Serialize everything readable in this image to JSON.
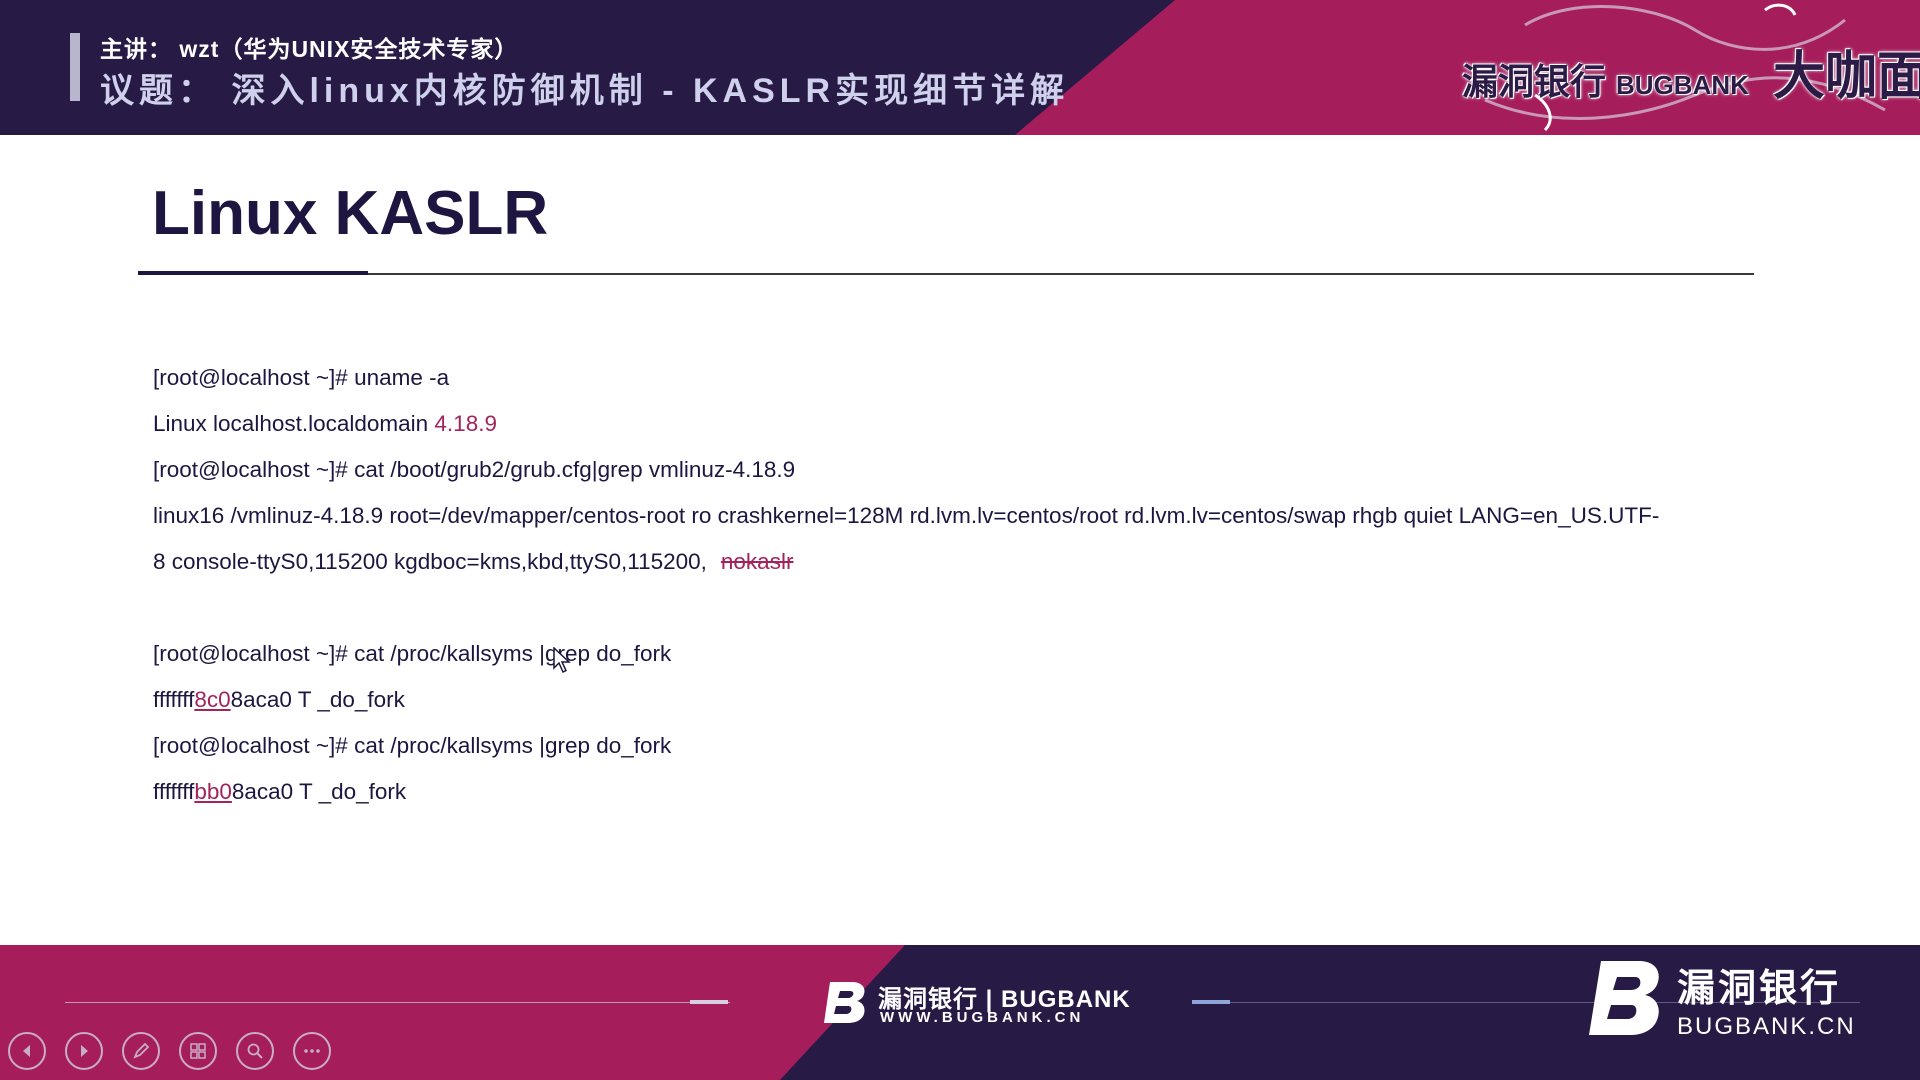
{
  "header": {
    "speaker": "主讲： wzt（华为UNIX安全技术专家）",
    "topic": "议题： 深入linux内核防御机制 - KASLR实现细节详解",
    "brand_cn": "漏洞银行",
    "brand_en": "BUGBANK",
    "brand_event": "大咖面对面"
  },
  "slide": {
    "title": "Linux KASLR",
    "console": {
      "cmd1": "[root@localhost ~]# uname -a",
      "out1_prefix": "Linux localhost.localdomain ",
      "out1_version": "4.18.9",
      "cmd2": "[root@localhost ~]# cat /boot/grub2/grub.cfg|grep vmlinuz-4.18.9",
      "out2_line1": "linux16 /vmlinuz-4.18.9 root=/dev/mapper/centos-root ro crashkernel=128M rd.lvm.lv=centos/root rd.lvm.lv=centos/swap rhgb quiet LANG=en_US.UTF-",
      "out2_line2": "8 console-ttyS0,115200 kgdboc=kms,kbd,ttyS0,115200,",
      "out2_strike": "nokaslr",
      "cmd3": "[root@localhost ~]# cat /proc/kallsyms |grep do_fork",
      "out3_prefix": "fffffff",
      "out3_hl": "8c0",
      "out3_suffix": "8aca0 T _do_fork",
      "cmd4": "[root@localhost ~]# cat /proc/kallsyms |grep do_fork",
      "out4_prefix": "fffffff",
      "out4_hl": "bb0",
      "out4_suffix": "8aca0 T _do_fork"
    }
  },
  "footer": {
    "mid_logo_name": "漏洞银行 | BUGBANK",
    "mid_logo_url": "WWW.BUGBANK.CN",
    "right_logo_cn": "漏洞银行",
    "right_logo_en": "BUGBANK.CN",
    "controls": [
      "previous-icon",
      "next-icon",
      "pen-icon",
      "grid-icon",
      "zoom-icon",
      "more-icon"
    ]
  },
  "colors": {
    "navy": "#271a45",
    "magenta": "#a61d5c",
    "title": "#1e1640",
    "highlight": "#a1245c"
  }
}
